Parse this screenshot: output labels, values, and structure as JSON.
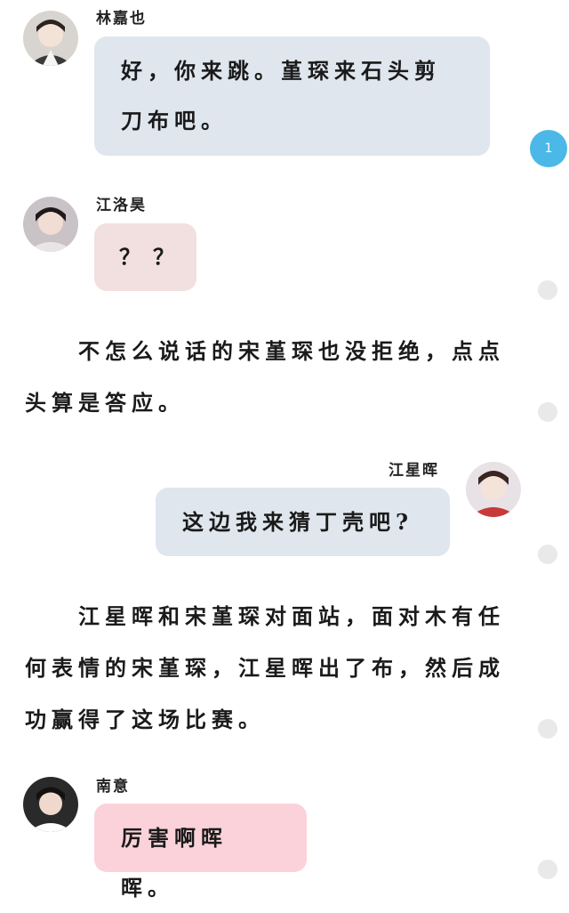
{
  "messages": [
    {
      "sender": "林嘉也",
      "text": "好，你来跳。堇琛来石头剪刀布吧。",
      "bubble_color": "#dfe6ee"
    },
    {
      "sender": "江洛昊",
      "text": "？？",
      "bubble_color": "#f2dfe0"
    },
    {
      "sender": "江星晖",
      "text": "这边我来猜丁壳吧?",
      "bubble_color": "#dfe6ee"
    },
    {
      "sender": "南意",
      "text": "厉害啊晖晖。",
      "bubble_color": "#fbd2da"
    }
  ],
  "narrations": [
    "不怎么说话的宋堇琛也没拒绝，点点头算是答应。",
    "江星晖和宋堇琛对面站，面对木有任何表情的宋堇琛，江星晖出了布，然后成功赢得了这场比赛。"
  ],
  "unread_badge": "1",
  "colors": {
    "badge": "#4bb8e8",
    "scroll_dot": "#e9e9e9"
  }
}
